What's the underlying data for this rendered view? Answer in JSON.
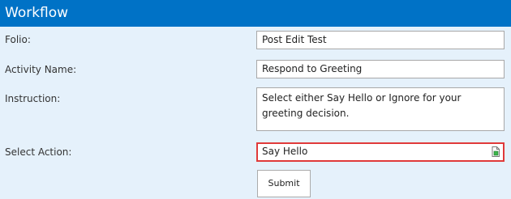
{
  "header": {
    "title": "Workflow"
  },
  "form": {
    "folio": {
      "label": "Folio:",
      "value": "Post Edit Test"
    },
    "activity_name": {
      "label": "Activity Name:",
      "value": "Respond to Greeting"
    },
    "instruction": {
      "label": "Instruction:",
      "value": "Select either Say Hello or Ignore for your greeting decision."
    },
    "select_action": {
      "label": "Select Action:",
      "value": "Say Hello",
      "icon": "dropdown-document-icon",
      "highlight_color": "#e03a3a"
    },
    "submit_label": "Submit"
  },
  "colors": {
    "header_bg": "#0072c6",
    "page_bg": "#e5f1fb",
    "icon_green": "#3cb44b"
  }
}
